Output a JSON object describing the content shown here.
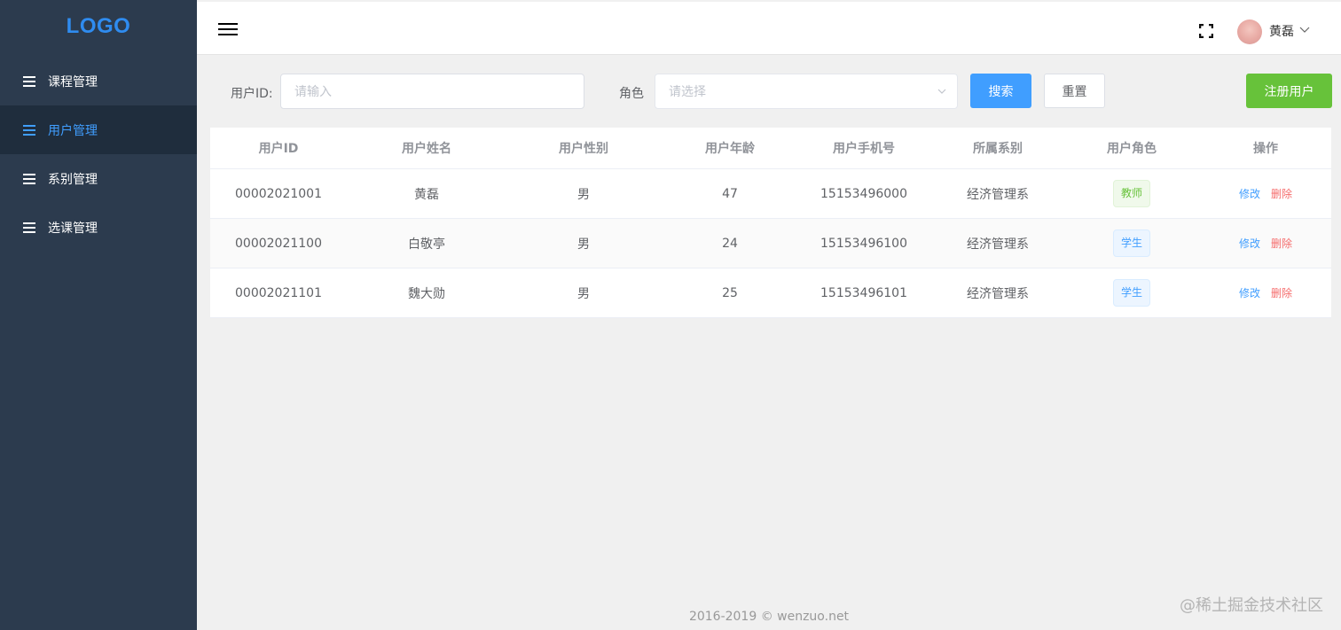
{
  "sidebar": {
    "logo": "LOGO",
    "items": [
      {
        "label": "课程管理"
      },
      {
        "label": "用户管理"
      },
      {
        "label": "系别管理"
      },
      {
        "label": "选课管理"
      }
    ]
  },
  "header": {
    "username": "黄磊"
  },
  "filter": {
    "user_id_label": "用户ID:",
    "user_id_placeholder": "请输入",
    "role_label": "角色",
    "role_placeholder": "请选择",
    "search_label": "搜索",
    "reset_label": "重置",
    "register_label": "注册用户"
  },
  "table": {
    "columns": [
      "用户ID",
      "用户姓名",
      "用户性别",
      "用户年龄",
      "用户手机号",
      "所属系别",
      "用户角色",
      "操作"
    ],
    "rows": [
      {
        "id": "00002021001",
        "name": "黄磊",
        "gender": "男",
        "age": "47",
        "phone": "15153496000",
        "dept": "经济管理系",
        "role": "教师",
        "edit": "修改",
        "delete": "删除"
      },
      {
        "id": "00002021100",
        "name": "白敬亭",
        "gender": "男",
        "age": "24",
        "phone": "15153496100",
        "dept": "经济管理系",
        "role": "学生",
        "edit": "修改",
        "delete": "删除"
      },
      {
        "id": "00002021101",
        "name": "魏大勋",
        "gender": "男",
        "age": "25",
        "phone": "15153496101",
        "dept": "经济管理系",
        "role": "学生",
        "edit": "修改",
        "delete": "删除"
      }
    ]
  },
  "footer": {
    "copyright": "2016-2019 © wenzuo.net"
  },
  "watermark": "@稀土掘金技术社区",
  "colors": {
    "sidebar_bg": "#2c3b4e",
    "accent": "#409eff",
    "success": "#67c23a",
    "danger": "#f56c6c"
  }
}
